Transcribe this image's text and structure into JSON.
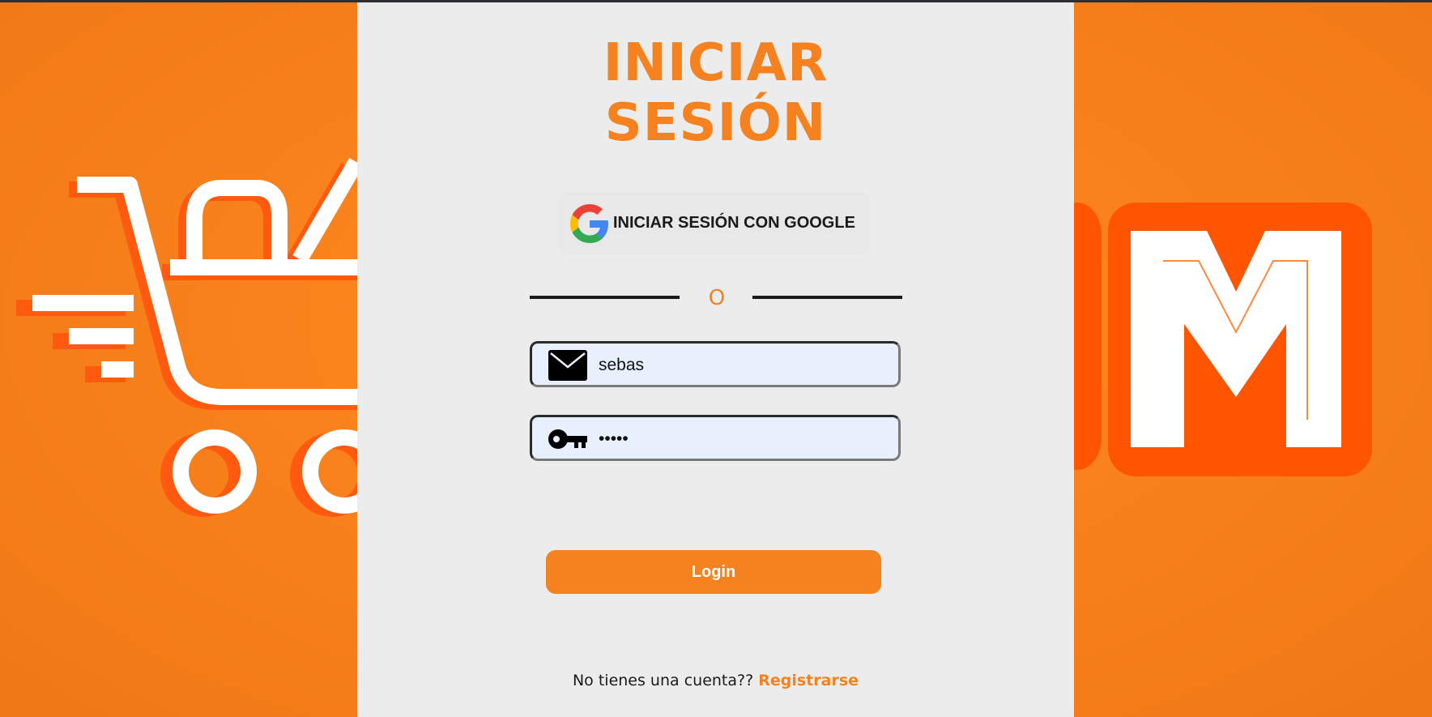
{
  "login": {
    "title_line1": "INICIAR",
    "title_line2": "SESIÓN",
    "google_button_label": "INICIAR SESIÓN CON GOOGLE",
    "divider_text": "O",
    "email_value": "sebas",
    "password_value": "•••••",
    "login_button_label": "Login",
    "register_prompt": "No tienes una cuenta?? ",
    "register_link": "Registrarse"
  },
  "icons": {
    "google": "google-icon",
    "email": "envelope-icon",
    "password": "key-icon",
    "background_left": "shopping-cart-illustration",
    "background_right": "letter-m-logo"
  },
  "colors": {
    "accent": "#f6821f",
    "panel_background": "#ececec",
    "input_background": "#e8f0fd",
    "text": "#1a1a1a"
  }
}
